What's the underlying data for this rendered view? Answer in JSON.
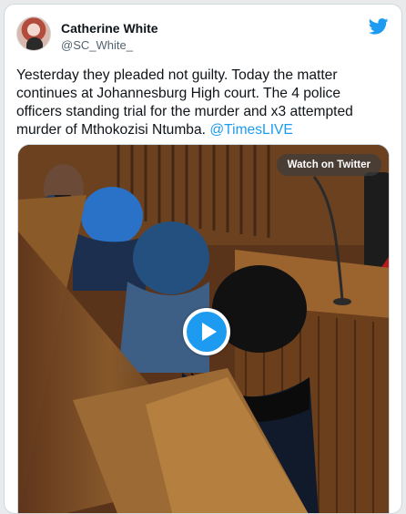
{
  "tweet": {
    "author_name": "Catherine White",
    "author_handle": "@SC_White_",
    "text_main": "Yesterday they pleaded not guilty. Today the matter continues at Johannesburg High court. The 4 police officers standing trial for the murder and x3 attempted murder of Mthokozisi Ntumba. ",
    "text_mention": "@TimesLIVE"
  },
  "media": {
    "watch_label": "Watch on Twitter",
    "play_icon": "play-icon"
  },
  "icons": {
    "brand": "twitter-bird-icon"
  },
  "colors": {
    "accent": "#1d9bf0",
    "text": "#0f1419",
    "secondary_text": "#536471"
  }
}
